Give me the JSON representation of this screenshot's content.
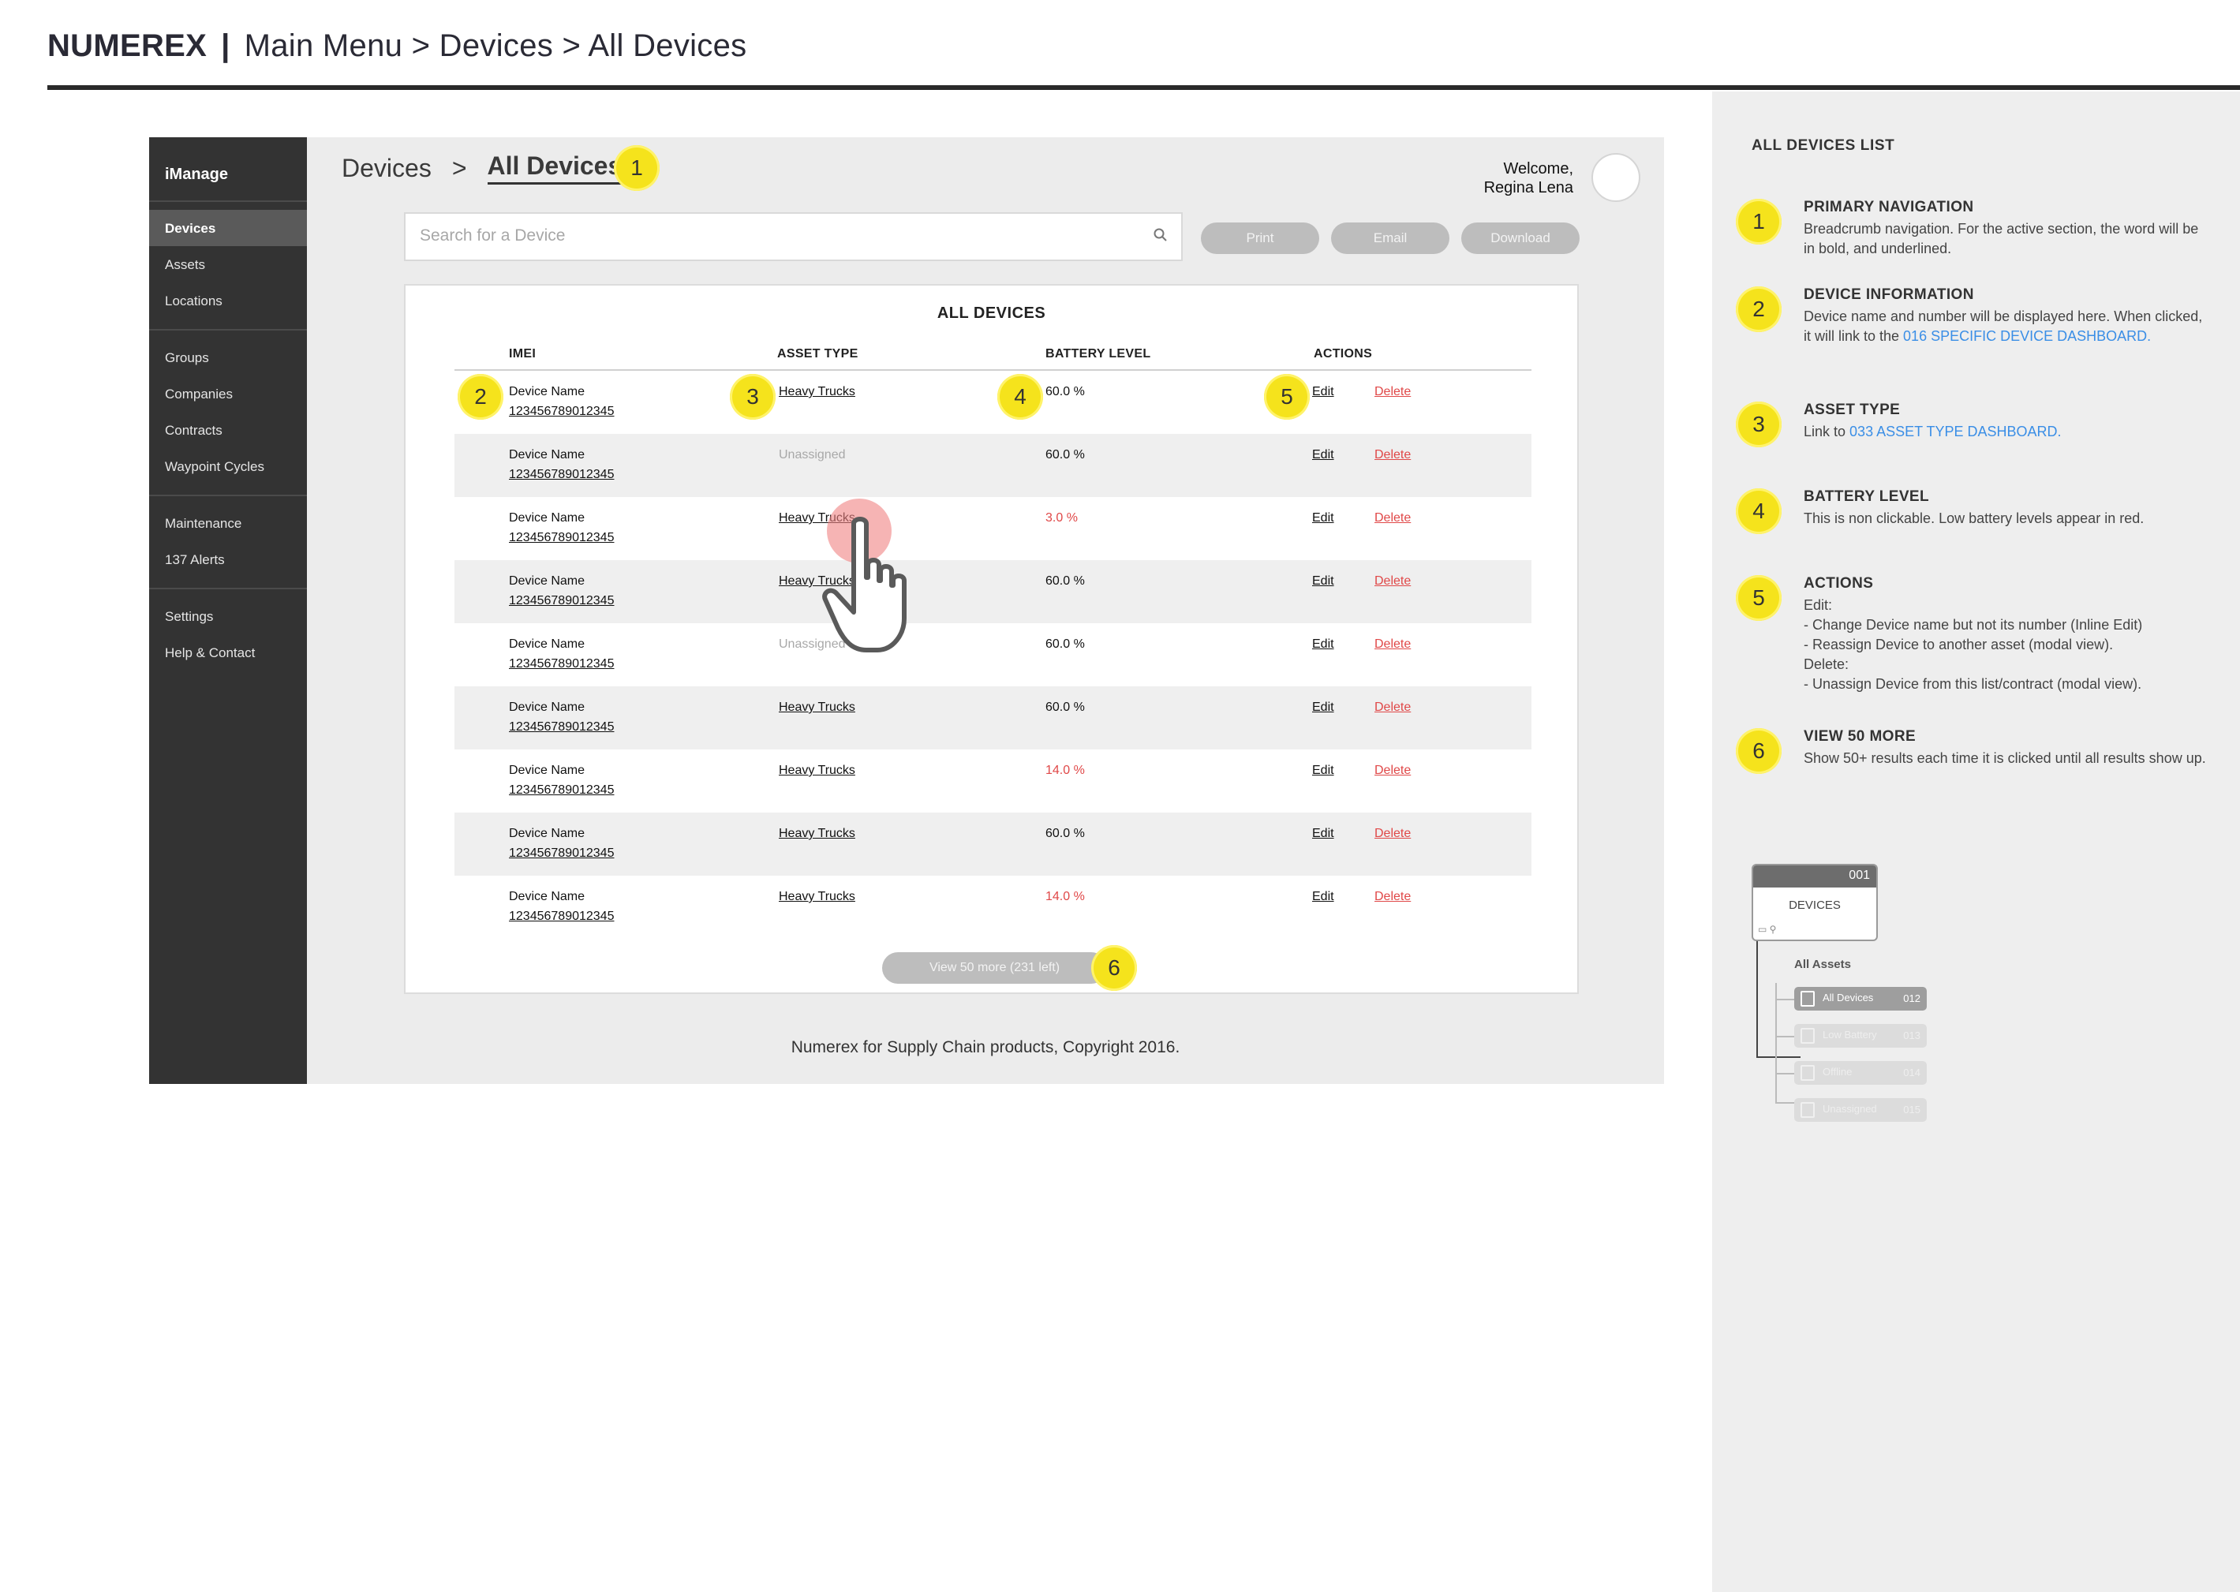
{
  "header": {
    "brand": "NUMEREX",
    "separator": "|",
    "path": "Main Menu > Devices > All Devices"
  },
  "sidebar": {
    "brand": "iManage",
    "items": [
      {
        "label": "Devices",
        "active": true
      },
      {
        "label": "Assets"
      },
      {
        "label": "Locations"
      },
      {
        "label": "Groups"
      },
      {
        "label": "Companies"
      },
      {
        "label": "Contracts"
      },
      {
        "label": "Waypoint Cycles"
      },
      {
        "label": "Maintenance"
      },
      {
        "label": "137 Alerts"
      },
      {
        "label": "Settings"
      },
      {
        "label": "Help & Contact"
      }
    ]
  },
  "breadcrumb": {
    "parent": "Devices",
    "separator": ">",
    "current": "All Devices"
  },
  "user": {
    "welcome": "Welcome,",
    "name": "Regina Lena"
  },
  "search": {
    "placeholder": "Search for a Device",
    "icon": "search-icon"
  },
  "toolbar": {
    "print": "Print",
    "email": "Email",
    "download": "Download"
  },
  "table": {
    "title": "ALL DEVICES",
    "columns": [
      "IMEI",
      "ASSET TYPE",
      "BATTERY LEVEL",
      "ACTIONS"
    ],
    "edit_label": "Edit",
    "delete_label": "Delete",
    "rows": [
      {
        "name": "Device Name",
        "imei": "123456789012345",
        "asset": "Heavy Trucks",
        "battery": "60.0 %",
        "low": false
      },
      {
        "name": "Device Name",
        "imei": "123456789012345",
        "asset": "Unassigned",
        "battery": "60.0 %",
        "low": false
      },
      {
        "name": "Device Name",
        "imei": "123456789012345",
        "asset": "Heavy Trucks",
        "battery": "3.0 %",
        "low": true
      },
      {
        "name": "Device Name",
        "imei": "123456789012345",
        "asset": "Heavy Trucks",
        "battery": "60.0 %",
        "low": false
      },
      {
        "name": "Device Name",
        "imei": "123456789012345",
        "asset": "Unassigned",
        "battery": "60.0 %",
        "low": false
      },
      {
        "name": "Device Name",
        "imei": "123456789012345",
        "asset": "Heavy Trucks",
        "battery": "60.0 %",
        "low": false
      },
      {
        "name": "Device Name",
        "imei": "123456789012345",
        "asset": "Heavy Trucks",
        "battery": "14.0 %",
        "low": true
      },
      {
        "name": "Device Name",
        "imei": "123456789012345",
        "asset": "Heavy Trucks",
        "battery": "60.0 %",
        "low": false
      },
      {
        "name": "Device Name",
        "imei": "123456789012345",
        "asset": "Heavy Trucks",
        "battery": "14.0 %",
        "low": true
      }
    ],
    "view_more": "View 50 more (231 left)"
  },
  "footer": "Numerex for Supply Chain products, Copyright 2016.",
  "annotations": {
    "badges": [
      "1",
      "2",
      "3",
      "4",
      "5",
      "6"
    ]
  },
  "notes": {
    "heading": "ALL DEVICES LIST",
    "items": [
      {
        "num": "1",
        "title": "PRIMARY NAVIGATION",
        "text": "Breadcrumb navigation. For the active section, the word will be in bold, and underlined."
      },
      {
        "num": "2",
        "title": "DEVICE INFORMATION",
        "text": "Device name and number will be displayed here. When clicked, it will link to the ",
        "link": "016 SPECIFIC DEVICE DASHBOARD."
      },
      {
        "num": "3",
        "title": "ASSET TYPE",
        "text": "Link to ",
        "link": "033 ASSET TYPE DASHBOARD."
      },
      {
        "num": "4",
        "title": "BATTERY LEVEL",
        "text": "This is non clickable. Low battery levels appear in red."
      },
      {
        "num": "5",
        "title": "ACTIONS",
        "lines": [
          "Edit:",
          "- Change Device name but not its number (Inline Edit)",
          "- Reassign Device to another asset (modal view).",
          "Delete:",
          "- Unassign Device from this list/contract (modal view)."
        ]
      },
      {
        "num": "6",
        "title": "VIEW 50 MORE",
        "text": "Show 50+ results each time it is clicked until all results show up."
      }
    ]
  },
  "sitemap": {
    "card_num": "001",
    "card_label": "DEVICES",
    "sub": "All Assets",
    "items": [
      {
        "label": "All Devices",
        "num": "012",
        "active": true
      },
      {
        "label": "Low Battery",
        "num": "013"
      },
      {
        "label": "Offline",
        "num": "014"
      },
      {
        "label": "Unassigned",
        "num": "015"
      }
    ]
  },
  "colors": {
    "accent_yellow": "#f5e31c",
    "sidebar_bg": "#333333",
    "low_battery": "#e04848",
    "link_blue": "#3a8ee6"
  }
}
